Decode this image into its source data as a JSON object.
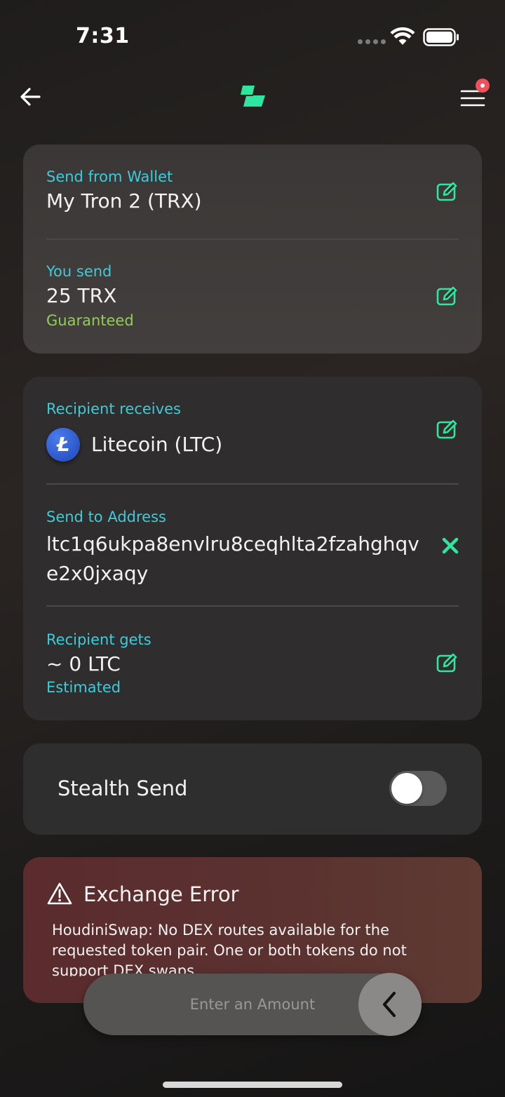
{
  "status_bar": {
    "time": "7:31"
  },
  "nav": {
    "back_icon": "arrow-left-icon",
    "logo_icon": "brand-logo-icon",
    "menu_icon": "hamburger-menu-icon"
  },
  "colors": {
    "accent_green": "#2ee6a0",
    "label_cyan": "#3ecbd9",
    "guaranteed_green": "#8fd14f",
    "error_bg": "#5b2b2e",
    "badge_red": "#f0505a"
  },
  "send_card": {
    "from_label": "Send from Wallet",
    "from_value": "My Tron 2 (TRX)",
    "send_label": "You send",
    "send_value": "25 TRX",
    "send_note": "Guaranteed"
  },
  "receive_card": {
    "receives_label": "Recipient receives",
    "coin_symbol_letter": "Ł",
    "coin_name": "Litecoin (LTC)",
    "address_label": "Send to Address",
    "address_value": "ltc1q6ukpa8envlru8ceqhlta2fzahghqve2x0jxaqy",
    "gets_label": "Recipient gets",
    "gets_value": "~ 0 LTC",
    "gets_note": "Estimated"
  },
  "stealth": {
    "label": "Stealth Send",
    "enabled": false
  },
  "error": {
    "title": "Exchange Error",
    "message": "HoudiniSwap: No DEX routes available for the requested token pair. One or both tokens do not support DEX swaps."
  },
  "amount": {
    "placeholder": "Enter an Amount"
  }
}
